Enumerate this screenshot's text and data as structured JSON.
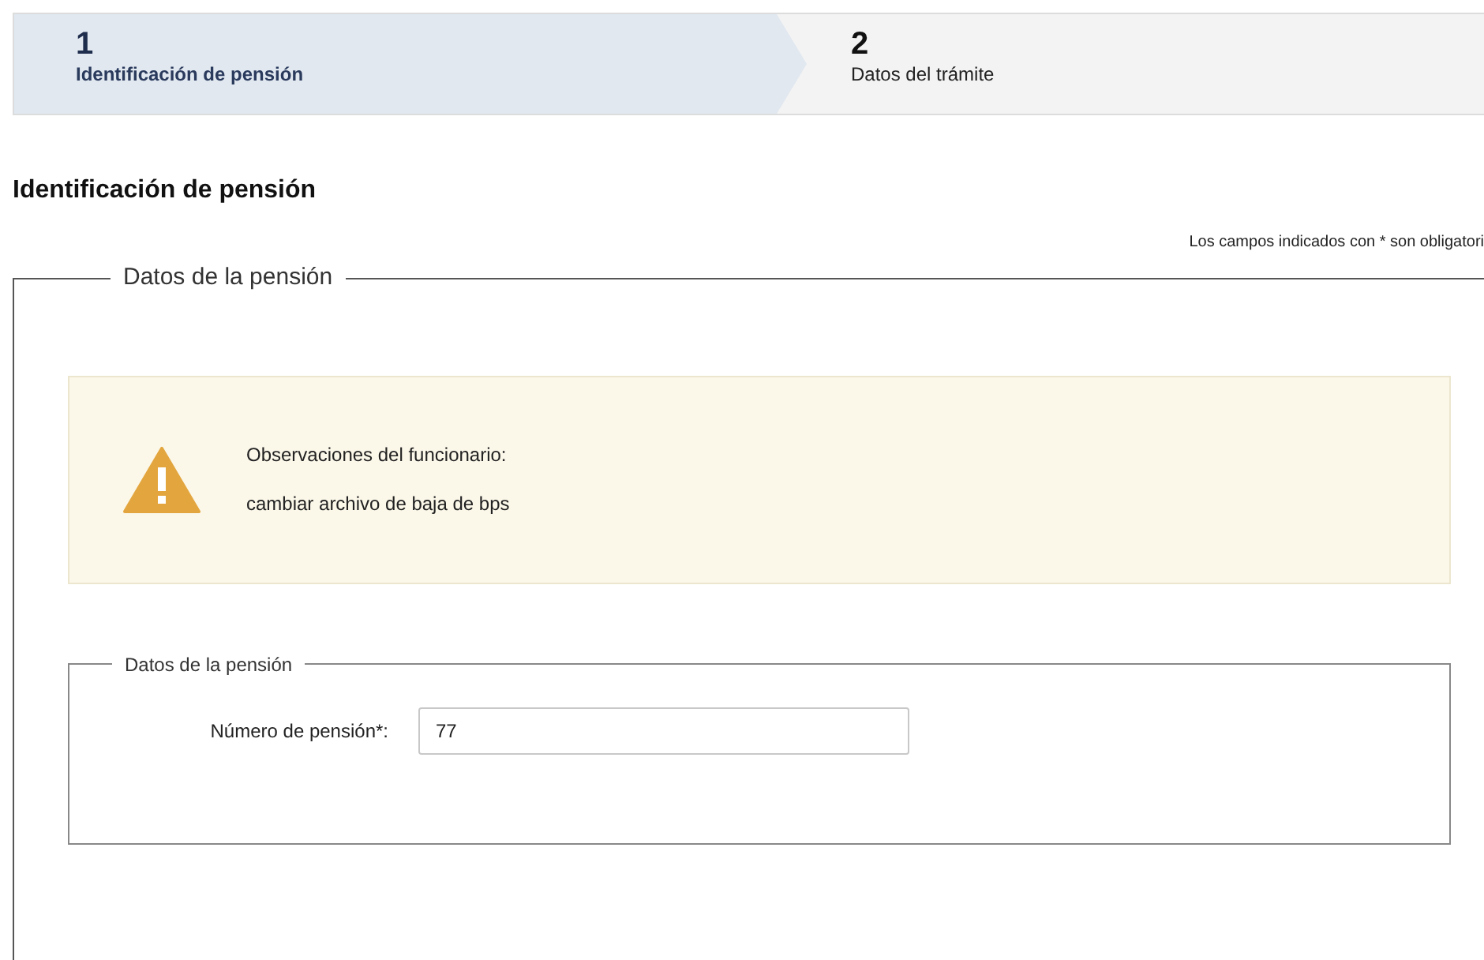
{
  "steps": [
    {
      "number": "1",
      "label": "Identificación de pensión",
      "selected": true
    },
    {
      "number": "2",
      "label": "Datos del trámite",
      "selected": false
    }
  ],
  "page_title": "Identificación de pensión",
  "required_note": "Los campos indicados con * son obligatori",
  "section": {
    "legend": "Datos de la pensión",
    "alert": {
      "kind": "warning",
      "title": "Observaciones del funcionario:",
      "message": "cambiar archivo de baja de bps"
    },
    "fieldset": {
      "legend": "Datos de la pensión",
      "fields": [
        {
          "label": "Número de pensión*:",
          "value": "77"
        }
      ]
    }
  }
}
